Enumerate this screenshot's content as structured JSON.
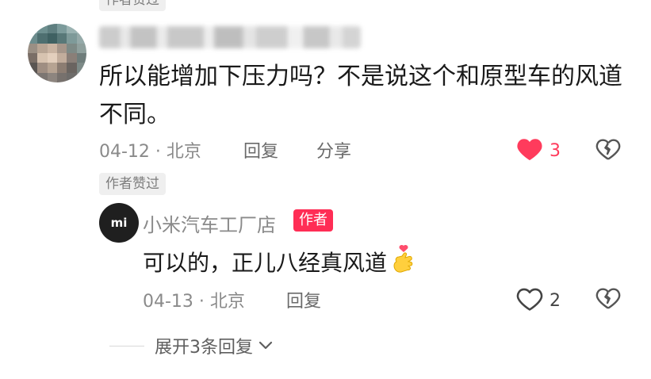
{
  "colors": {
    "like_red": "#ff3b5c",
    "badge_red": "#ff2d55",
    "meta_gray": "#8a8a8a",
    "tag_bg": "#efefef"
  },
  "top_tag": "作者赞过",
  "comment": {
    "text": "所以能增加下压力吗？不是说这个和原型车的风道不同。",
    "date_location": "04-12 · 北京",
    "reply_label": "回复",
    "share_label": "分享",
    "like_count": "3",
    "liked": true,
    "author_liked_tag": "作者赞过",
    "icons": {
      "like": "heart-filled-icon",
      "dislike": "broken-heart-icon"
    }
  },
  "reply": {
    "avatar_logo": "mi",
    "username": "小米汽车工厂店",
    "badge": "作者",
    "text": "可以的，正儿八经真风道",
    "emoji": "🫰",
    "date_location": "04-13 · 北京",
    "reply_label": "回复",
    "like_count": "2",
    "icons": {
      "like": "heart-outline-icon",
      "dislike": "broken-heart-icon"
    }
  },
  "expand": {
    "label": "展开3条回复",
    "icon": "chevron-down-icon"
  }
}
